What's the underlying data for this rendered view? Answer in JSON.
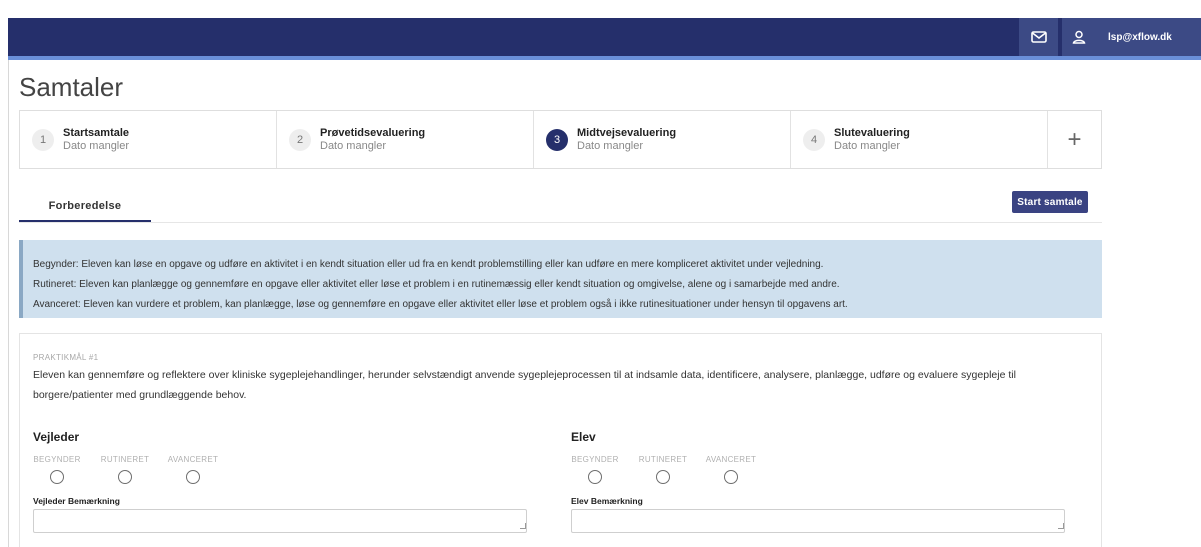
{
  "topbar": {
    "mail_icon": "mail-icon",
    "user_icon": "user-icon",
    "user_email": "lsp@xflow.dk",
    "background": "#252f6b"
  },
  "page": {
    "title": "Samtaler"
  },
  "stepper": {
    "steps": [
      {
        "num": "1",
        "title": "Startsamtale",
        "sub": "Dato mangler"
      },
      {
        "num": "2",
        "title": "Prøvetidsevaluering",
        "sub": "Dato mangler"
      },
      {
        "num": "3",
        "title": "Midtvejsevaluering",
        "sub": "Dato mangler"
      },
      {
        "num": "4",
        "title": "Slutevaluering",
        "sub": "Dato mangler"
      }
    ],
    "active_step": "3",
    "add_label": "+"
  },
  "tabs": {
    "preparation": "Forberedelse"
  },
  "actions": {
    "start_label": "Start samtale"
  },
  "info": {
    "lines": [
      "Begynder: Eleven kan løse en opgave og udføre en aktivitet i en kendt situation eller ud fra en kendt problemstilling eller kan udføre en mere kompliceret aktivitet under vejledning.",
      "Rutineret: Eleven kan planlægge og gennemføre en opgave eller aktivitet eller løse et problem i en rutinemæssig eller kendt situation og omgivelse, alene og i samarbejde med andre.",
      "Avanceret: Eleven kan vurdere et problem, kan planlægge, løse og gennemføre en opgave eller aktivitet eller løse et problem også i ikke rutinesituationer under hensyn til opgavens art."
    ]
  },
  "goal": {
    "label": "PRAKTIKMÅL #1",
    "text": "Eleven kan gennemføre og reflektere over kliniske sygeplejehandlinger, herunder selvstændigt anvende sygeplejeprocessen til at indsamle data, identificere, analysere, planlægge, udføre og evaluere sygepleje til borgere/patienter med grundlæggende behov.",
    "levels": [
      "BEGYNDER",
      "RUTINERET",
      "AVANCERET"
    ],
    "supervisor": {
      "title": "Vejleder",
      "comment_label": "Vejleder Bemærkning",
      "comment_value": ""
    },
    "student": {
      "title": "Elev",
      "comment_label": "Elev Bemærkning",
      "comment_value": ""
    }
  }
}
